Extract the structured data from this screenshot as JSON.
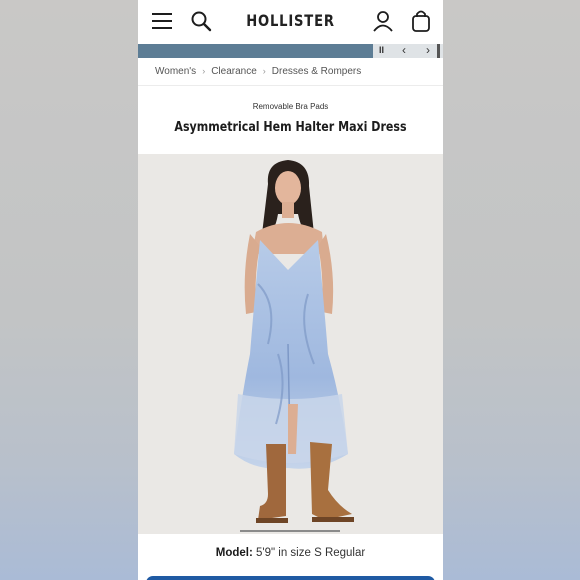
{
  "header": {
    "brand": "HOLLISTER",
    "icons": [
      "menu-icon",
      "search-icon",
      "account-icon",
      "bag-icon"
    ]
  },
  "promo": {
    "controls": {
      "pause": "II",
      "prev": "‹",
      "next": "›"
    },
    "progress": 0.77
  },
  "breadcrumb": [
    "Women's",
    "Clearance",
    "Dresses & Rompers"
  ],
  "product": {
    "tagline": "Removable Bra Pads",
    "title": "Asymmetrical Hem Halter Maxi Dress",
    "model_label": "Model:",
    "model_text": " 5'9\" in size S Regular"
  },
  "colors": {
    "brand_navy": "#5d7d95",
    "cta_blue": "#1f5aa3",
    "dress_blue": "#a9c1e2"
  }
}
